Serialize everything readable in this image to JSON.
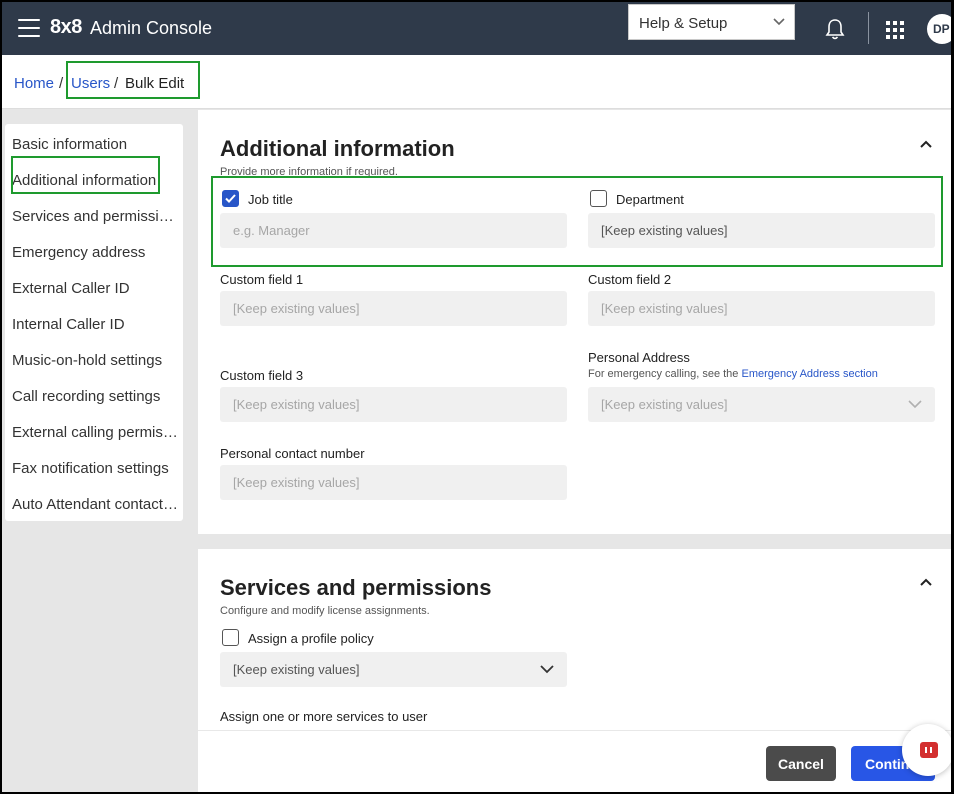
{
  "header": {
    "logo": "8x8",
    "app_title": "Admin Console",
    "help_menu": "Help & Setup",
    "avatar_initials": "DP"
  },
  "breadcrumb": {
    "home": "Home",
    "sep1": "/",
    "users": "Users",
    "sep2": "/",
    "current": "Bulk Edit"
  },
  "sidenav": {
    "items": [
      "Basic information",
      "Additional information",
      "Services and permissions",
      "Emergency address",
      "External Caller ID",
      "Internal Caller ID",
      "Music-on-hold settings",
      "Call recording settings",
      "External calling permissions",
      "Fax notification settings",
      "Auto Attendant contact settings"
    ]
  },
  "additional": {
    "title": "Additional information",
    "subtitle": "Provide more information if required.",
    "job_title": {
      "label": "Job title",
      "checked": true,
      "placeholder": "e.g. Manager"
    },
    "department": {
      "label": "Department",
      "checked": false,
      "value": "[Keep existing values]"
    },
    "custom1": {
      "label": "Custom field 1",
      "value": "[Keep existing values]"
    },
    "custom2": {
      "label": "Custom field 2",
      "value": "[Keep existing values]"
    },
    "custom3": {
      "label": "Custom field 3",
      "value": "[Keep existing values]"
    },
    "personal_address": {
      "label": "Personal Address",
      "help_prefix": "For emergency calling, see the",
      "help_link": "Emergency Address section",
      "value": "[Keep existing values]"
    },
    "personal_contact": {
      "label": "Personal contact number",
      "value": "[Keep existing values]"
    }
  },
  "services": {
    "title": "Services and permissions",
    "subtitle": "Configure and modify license assignments.",
    "profile_policy": {
      "label": "Assign a profile policy",
      "checked": false,
      "value": "[Keep existing values]"
    },
    "assign_services_label": "Assign one or more services to user"
  },
  "footer": {
    "cancel": "Cancel",
    "continue": "Continue"
  },
  "colors": {
    "topbar": "#2f3a4a",
    "link": "#2856c8",
    "primary_button": "#2856e6",
    "highlight": "#1e9a2e"
  }
}
